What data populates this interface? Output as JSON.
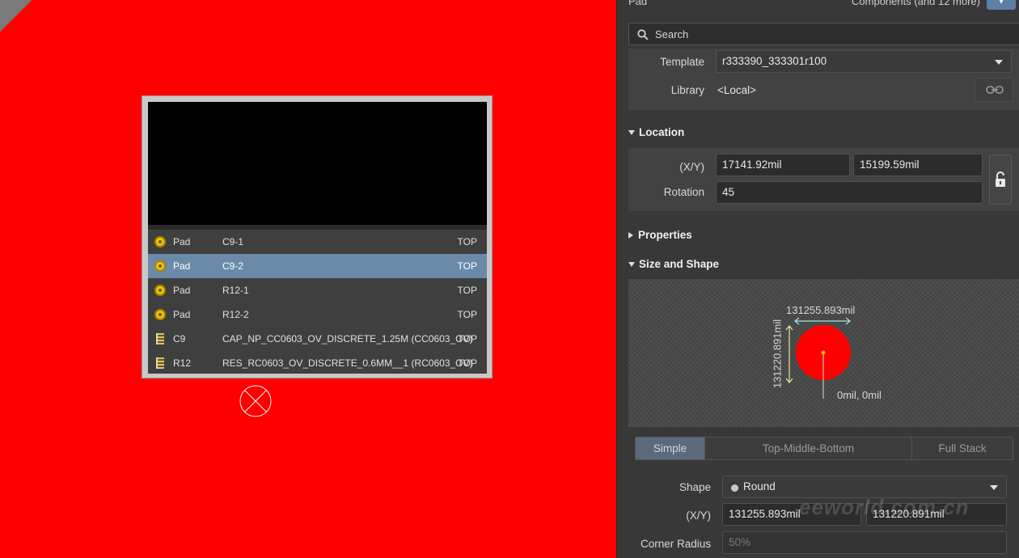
{
  "canvas": {
    "pick_list": [
      {
        "icon": "pad-icon",
        "type": "Pad",
        "name": "C9-1",
        "layer": "TOP",
        "selected": false
      },
      {
        "icon": "pad-icon",
        "type": "Pad",
        "name": "C9-2",
        "layer": "TOP",
        "selected": true
      },
      {
        "icon": "pad-icon",
        "type": "Pad",
        "name": "R12-1",
        "layer": "TOP",
        "selected": false
      },
      {
        "icon": "pad-icon",
        "type": "Pad",
        "name": "R12-2",
        "layer": "TOP",
        "selected": false
      },
      {
        "icon": "component-icon",
        "type": "C9",
        "name": "CAP_NP_CC0603_OV_DISCRETE_1.25M (CC0603_OV)",
        "layer": "TOP",
        "selected": false
      },
      {
        "icon": "component-icon",
        "type": "R12",
        "name": "RES_RC0603_OV_DISCRETE_0.6MM__1 (RC0603_OV)",
        "layer": "TOP",
        "selected": false
      }
    ],
    "colors": {
      "copper": "#ff0000",
      "selection": "#6a8aa8"
    }
  },
  "panel": {
    "header_left": "Pad",
    "header_right": "Components (and 12 more)",
    "search_placeholder": "Search",
    "template_label": "Template",
    "template_value": "r333390_333301r100",
    "library_label": "Library",
    "library_value": "<Local>",
    "location": {
      "title": "Location",
      "xy_label": "(X/Y)",
      "x": "17141.92mil",
      "y": "15199.59mil",
      "rotation_label": "Rotation",
      "rotation": "45"
    },
    "properties_title": "Properties",
    "size_shape": {
      "title": "Size and Shape",
      "width_dim": "131255.893mil",
      "height_dim": "131220.891mil",
      "origin": "0mil, 0mil",
      "tabs": [
        {
          "label": "Simple",
          "active": true
        },
        {
          "label": "Top-Middle-Bottom",
          "active": false
        },
        {
          "label": "Full Stack",
          "active": false
        }
      ],
      "shape_label": "Shape",
      "shape_value": "Round",
      "xy_label": "(X/Y)",
      "size_x": "131255.893mil",
      "size_y": "131220.891mil",
      "corner_label": "Corner Radius",
      "corner_value": "50%"
    },
    "watermark": "eeworld.com.cn"
  }
}
